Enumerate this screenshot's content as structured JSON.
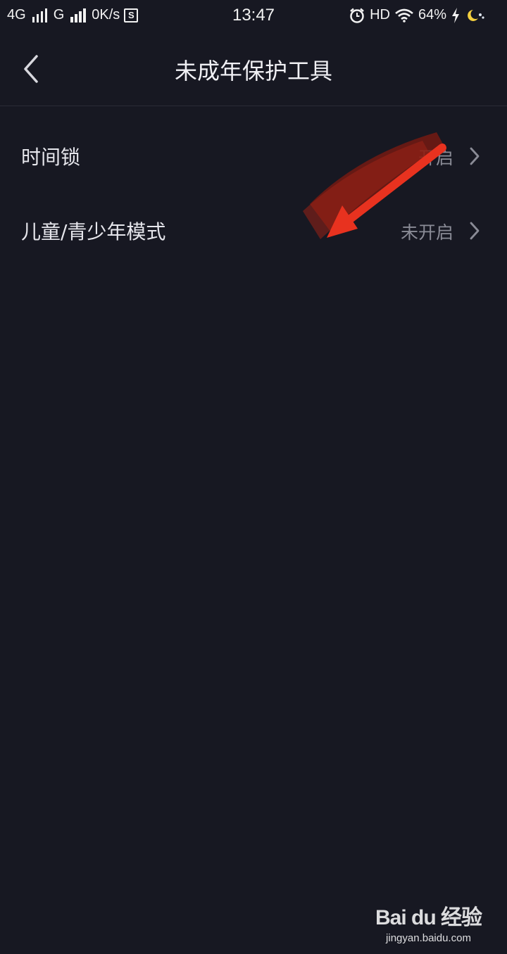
{
  "status_bar": {
    "network1": "4G",
    "network2": "G",
    "speed": "0K/s",
    "box_icon_letter": "S",
    "time": "13:47",
    "hd": "HD",
    "battery": "64%",
    "icons": [
      "signal-icon",
      "box-s-icon",
      "alarm-icon",
      "wifi-icon",
      "charging-icon",
      "night-mode-icon"
    ]
  },
  "nav": {
    "title": "未成年保护工具",
    "back_icon": "chevron-left-icon"
  },
  "items": [
    {
      "label": "时间锁",
      "value": "开启"
    },
    {
      "label": "儿童/青少年模式",
      "value": "未开启"
    }
  ],
  "annotation": {
    "color": "#e8321f"
  },
  "watermark": {
    "logo": "Bai du 经验",
    "url": "jingyan.baidu.com"
  }
}
